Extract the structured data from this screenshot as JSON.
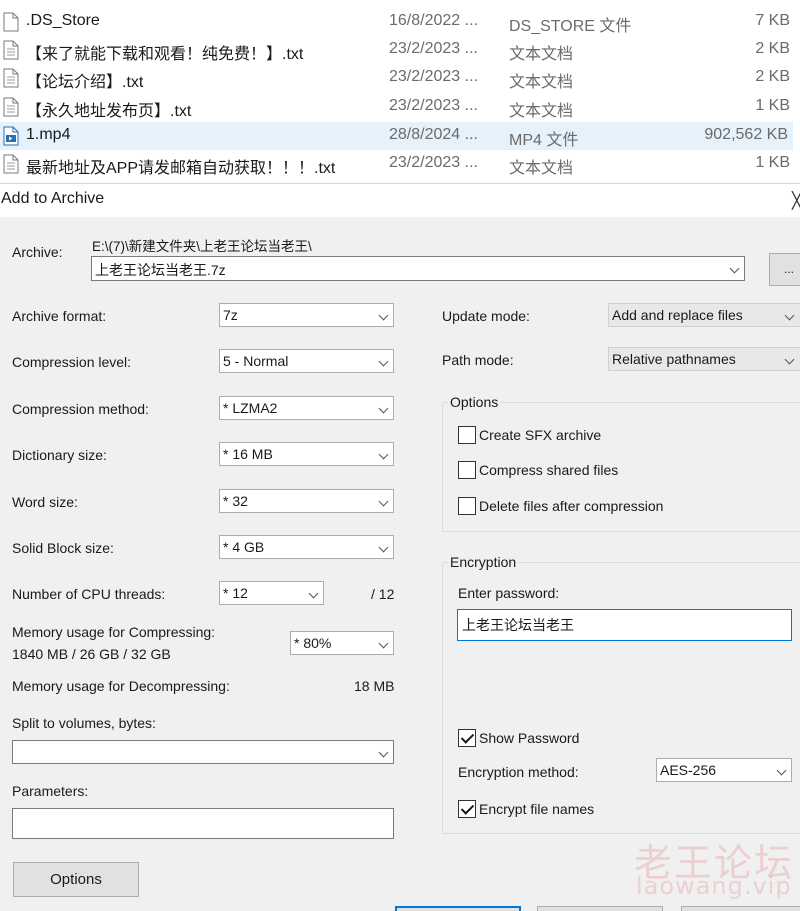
{
  "file_list": {
    "rows": [
      {
        "name": ".DS_Store",
        "date": "16/8/2022 ...",
        "type": "DS_STORE 文件",
        "size": "7 KB",
        "icon": "blank-file-icon",
        "selected": false
      },
      {
        "name": "【来了就能下载和观看！纯免费！】.txt",
        "date": "23/2/2023 ...",
        "type": "文本文档",
        "size": "2 KB",
        "icon": "text-file-icon",
        "selected": false
      },
      {
        "name": "【论坛介绍】.txt",
        "date": "23/2/2023 ...",
        "type": "文本文档",
        "size": "2 KB",
        "icon": "text-file-icon",
        "selected": false
      },
      {
        "name": "【永久地址发布页】.txt",
        "date": "23/2/2023 ...",
        "type": "文本文档",
        "size": "1 KB",
        "icon": "text-file-icon",
        "selected": false
      },
      {
        "name": "1.mp4",
        "date": "28/8/2024 ...",
        "type": "MP4 文件",
        "size": "902,562 KB",
        "icon": "video-file-icon",
        "selected": true
      },
      {
        "name": "最新地址及APP请发邮箱自动获取！！！.txt",
        "date": "23/2/2023 ...",
        "type": "文本文档",
        "size": "1 KB",
        "icon": "text-file-icon",
        "selected": false
      }
    ]
  },
  "dialog": {
    "title": "Add to Archive",
    "close_glyph": "╳",
    "archive": {
      "label": "Archive:",
      "path": "E:\\(7)\\新建文件夹\\上老王论坛当老王\\",
      "filename": "上老王论坛当老王.7z",
      "browse_label": "..."
    },
    "left": {
      "archive_format": {
        "label": "Archive format:",
        "value": "7z"
      },
      "compression_level": {
        "label": "Compression level:",
        "value": "5 - Normal"
      },
      "compression_method": {
        "label": "Compression method:",
        "value": "* LZMA2"
      },
      "dictionary_size": {
        "label": "Dictionary size:",
        "value": "* 16 MB"
      },
      "word_size": {
        "label": "Word size:",
        "value": "* 32"
      },
      "solid_block_size": {
        "label": "Solid Block size:",
        "value": "* 4 GB"
      },
      "cpu_threads": {
        "label": "Number of CPU threads:",
        "value": "* 12",
        "max": "/ 12"
      },
      "memory_compress": {
        "label": "Memory usage for Compressing:",
        "detail": "1840 MB / 26 GB / 32 GB",
        "value": "* 80%"
      },
      "memory_decompress": {
        "label": "Memory usage for Decompressing:",
        "value": "18 MB"
      },
      "split_volumes": {
        "label": "Split to volumes, bytes:",
        "value": ""
      },
      "parameters": {
        "label": "Parameters:",
        "value": ""
      },
      "options_button": "Options"
    },
    "right": {
      "update_mode": {
        "label": "Update mode:",
        "value": "Add and replace files"
      },
      "path_mode": {
        "label": "Path mode:",
        "value": "Relative pathnames"
      },
      "options_group": {
        "title": "Options",
        "create_sfx": {
          "label": "Create SFX archive",
          "checked": false
        },
        "compress_shared": {
          "label": "Compress shared files",
          "checked": false
        },
        "delete_after": {
          "label": "Delete files after compression",
          "checked": false
        }
      },
      "encryption_group": {
        "title": "Encryption",
        "password_label": "Enter password:",
        "password_value": "上老王论坛当老王",
        "show_password": {
          "label": "Show Password",
          "checked": true
        },
        "method_label": "Encryption method:",
        "method_value": "AES-256",
        "encrypt_names": {
          "label": "Encrypt file names",
          "checked": true
        }
      }
    }
  },
  "watermark": {
    "text_cn": "老王论坛",
    "text_en": "laowang.vip"
  },
  "colors": {
    "selection": "#e5f1fb",
    "dialog_bg": "#f0f0f0",
    "accent": "#0078d7",
    "watermark": "#dc3c46"
  }
}
